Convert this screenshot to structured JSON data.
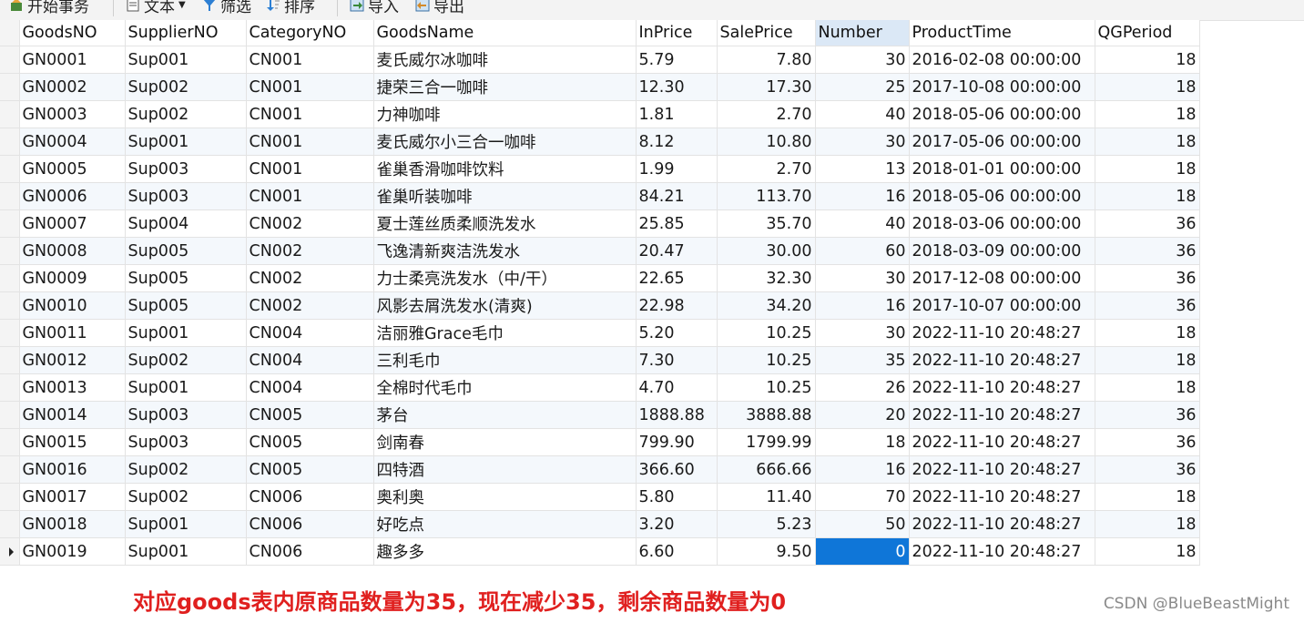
{
  "toolbar": {
    "begin_transaction": "开始事务",
    "text": "文本",
    "filter": "筛选",
    "sort": "排序",
    "import": "导入",
    "export": "导出"
  },
  "grid": {
    "columns": [
      "GoodsNO",
      "SupplierNO",
      "CategoryNO",
      "GoodsName",
      "InPrice",
      "SalePrice",
      "Number",
      "ProductTime",
      "QGPeriod"
    ],
    "selected_column": "Number",
    "rows": [
      [
        "GN0001",
        "Sup001",
        "CN001",
        "麦氏威尔冰咖啡",
        "5.79",
        "7.80",
        "30",
        "2016-02-08 00:00:00",
        "18"
      ],
      [
        "GN0002",
        "Sup002",
        "CN001",
        "捷荣三合一咖啡",
        "12.30",
        "17.30",
        "25",
        "2017-10-08 00:00:00",
        "18"
      ],
      [
        "GN0003",
        "Sup002",
        "CN001",
        "力神咖啡",
        "1.81",
        "2.70",
        "40",
        "2018-05-06 00:00:00",
        "18"
      ],
      [
        "GN0004",
        "Sup001",
        "CN001",
        "麦氏威尔小三合一咖啡",
        "8.12",
        "10.80",
        "30",
        "2017-05-06 00:00:00",
        "18"
      ],
      [
        "GN0005",
        "Sup003",
        "CN001",
        "雀巢香滑咖啡饮料",
        "1.99",
        "2.70",
        "13",
        "2018-01-01 00:00:00",
        "18"
      ],
      [
        "GN0006",
        "Sup003",
        "CN001",
        "雀巢听装咖啡",
        "84.21",
        "113.70",
        "16",
        "2018-05-06 00:00:00",
        "18"
      ],
      [
        "GN0007",
        "Sup004",
        "CN002",
        "夏士莲丝质柔顺洗发水",
        "25.85",
        "35.70",
        "40",
        "2018-03-06 00:00:00",
        "36"
      ],
      [
        "GN0008",
        "Sup005",
        "CN002",
        "飞逸清新爽洁洗发水",
        "20.47",
        "30.00",
        "60",
        "2018-03-09 00:00:00",
        "36"
      ],
      [
        "GN0009",
        "Sup005",
        "CN002",
        "力士柔亮洗发水（中/干）",
        "22.65",
        "32.30",
        "30",
        "2017-12-08 00:00:00",
        "36"
      ],
      [
        "GN0010",
        "Sup005",
        "CN002",
        "风影去屑洗发水(清爽)",
        "22.98",
        "34.20",
        "16",
        "2017-10-07 00:00:00",
        "36"
      ],
      [
        "GN0011",
        "Sup001",
        "CN004",
        "洁丽雅Grace毛巾",
        "5.20",
        "10.25",
        "30",
        "2022-11-10 20:48:27",
        "18"
      ],
      [
        "GN0012",
        "Sup002",
        "CN004",
        "三利毛巾",
        "7.30",
        "10.25",
        "35",
        "2022-11-10 20:48:27",
        "18"
      ],
      [
        "GN0013",
        "Sup001",
        "CN004",
        "全棉时代毛巾",
        "4.70",
        "10.25",
        "26",
        "2022-11-10 20:48:27",
        "18"
      ],
      [
        "GN0014",
        "Sup003",
        "CN005",
        "茅台",
        "1888.88",
        "3888.88",
        "20",
        "2022-11-10 20:48:27",
        "36"
      ],
      [
        "GN0015",
        "Sup003",
        "CN005",
        "剑南春",
        "799.90",
        "1799.99",
        "18",
        "2022-11-10 20:48:27",
        "36"
      ],
      [
        "GN0016",
        "Sup002",
        "CN005",
        "四特酒",
        "366.60",
        "666.66",
        "16",
        "2022-11-10 20:48:27",
        "36"
      ],
      [
        "GN0017",
        "Sup002",
        "CN006",
        "奥利奥",
        "5.80",
        "11.40",
        "70",
        "2022-11-10 20:48:27",
        "18"
      ],
      [
        "GN0018",
        "Sup001",
        "CN006",
        "好吃点",
        "3.20",
        "5.23",
        "50",
        "2022-11-10 20:48:27",
        "18"
      ],
      [
        "GN0019",
        "Sup001",
        "CN006",
        "趣多多",
        "6.60",
        "9.50",
        "0",
        "2022-11-10 20:48:27",
        "18"
      ]
    ],
    "current_row_index": 18
  },
  "annotation": "对应goods表内原商品数量为35，现在减少35，剩余商品数量为0",
  "watermark": "CSDN @BlueBeastMight",
  "colors": {
    "selection": "#0f76d8",
    "caption": "#e0201f",
    "alt_row": "#f4f8fc"
  }
}
